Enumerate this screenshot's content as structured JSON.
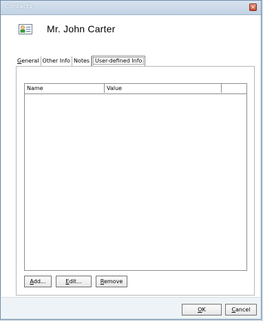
{
  "window": {
    "title": "Contacts",
    "close_glyph": "×"
  },
  "header": {
    "icon": "contact-card-icon",
    "name": "Mr. John Carter"
  },
  "tabs": [
    {
      "label": "General",
      "accel": "G",
      "rest": "eneral",
      "active": false
    },
    {
      "label": "Other Info",
      "active": false
    },
    {
      "label": "Notes",
      "active": false
    },
    {
      "label": "User-defined Info",
      "active": true
    }
  ],
  "list": {
    "columns": [
      "Name",
      "Value"
    ],
    "rows": []
  },
  "buttons": {
    "add": {
      "accel": "A",
      "rest": "dd..."
    },
    "edit": {
      "accel": "E",
      "rest": "dit..."
    },
    "remove": {
      "accel": "R",
      "rest": "emove"
    },
    "ok": {
      "accel": "O",
      "rest": "K"
    },
    "cancel": {
      "pre": "",
      "accel": "C",
      "rest": "ancel"
    }
  },
  "colors": {
    "titlebar": "#c3d3e4",
    "close": "#c2472b",
    "frame": "#6f8aa5"
  }
}
